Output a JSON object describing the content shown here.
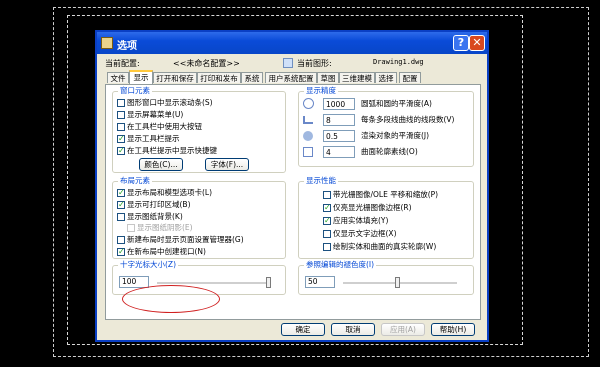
{
  "dialog": {
    "title": "选项",
    "help_glyph": "?",
    "close_glyph": "✕"
  },
  "profile": {
    "current_profile_label": "当前配置:",
    "current_profile_value": "<<未命名配置>>",
    "current_drawing_label": "当前图形:",
    "current_drawing_value": "Drawing1.dwg"
  },
  "tabs": [
    "文件",
    "显示",
    "打开和保存",
    "打印和发布",
    "系统",
    "用户系统配置",
    "草图",
    "三维建模",
    "选择",
    "配置"
  ],
  "active_tab": "显示",
  "window_elements": {
    "title": "窗口元素",
    "options": [
      {
        "label": "图形窗口中显示滚动条(S)",
        "checked": false
      },
      {
        "label": "显示屏幕菜单(U)",
        "checked": false
      },
      {
        "label": "在工具栏中使用大按钮",
        "checked": false
      },
      {
        "label": "显示工具栏提示",
        "checked": true
      },
      {
        "label": "在工具栏提示中显示快捷键",
        "checked": true
      }
    ],
    "colors_button": "颜色(C)...",
    "fonts_button": "字体(F)..."
  },
  "layout_elements": {
    "title": "布局元素",
    "options": [
      {
        "label": "显示布局和模型选项卡(L)",
        "checked": true,
        "disabled": false
      },
      {
        "label": "显示可打印区域(B)",
        "checked": true,
        "disabled": false
      },
      {
        "label": "显示图纸背景(K)",
        "checked": false,
        "disabled": false
      },
      {
        "label": "显示图纸阴影(E)",
        "checked": false,
        "disabled": true
      },
      {
        "label": "新建布局时显示页面设置管理器(G)",
        "checked": false,
        "disabled": false
      },
      {
        "label": "在新布局中创建视口(N)",
        "checked": true,
        "disabled": false
      }
    ]
  },
  "crosshair": {
    "title": "十字光标大小(Z)",
    "value": "100",
    "level": 1.0
  },
  "display_resolution": {
    "title": "显示精度",
    "items": [
      {
        "value": "1000",
        "label": "圆弧和圆的平滑度(A)"
      },
      {
        "value": "8",
        "label": "每条多段线曲线的线段数(V)"
      },
      {
        "value": "0.5",
        "label": "渲染对象的平滑度(J)"
      },
      {
        "value": "4",
        "label": "曲面轮廓素线(O)"
      }
    ]
  },
  "display_performance": {
    "title": "显示性能",
    "options": [
      {
        "label": "带光栅图像/OLE 平移和缩放(P)",
        "checked": false
      },
      {
        "label": "仅亮显光栅图像边框(R)",
        "checked": true
      },
      {
        "label": "应用实体填充(Y)",
        "checked": true
      },
      {
        "label": "仅显示文字边框(X)",
        "checked": false
      },
      {
        "label": "绘制实体和曲面的真实轮廓(W)",
        "checked": false
      }
    ]
  },
  "xref_fade": {
    "title": "参照编辑的褪色度(I)",
    "value": "50",
    "level": 0.5
  },
  "footer": {
    "ok": "确定",
    "cancel": "取消",
    "apply": "应用(A)",
    "help": "帮助(H)"
  }
}
